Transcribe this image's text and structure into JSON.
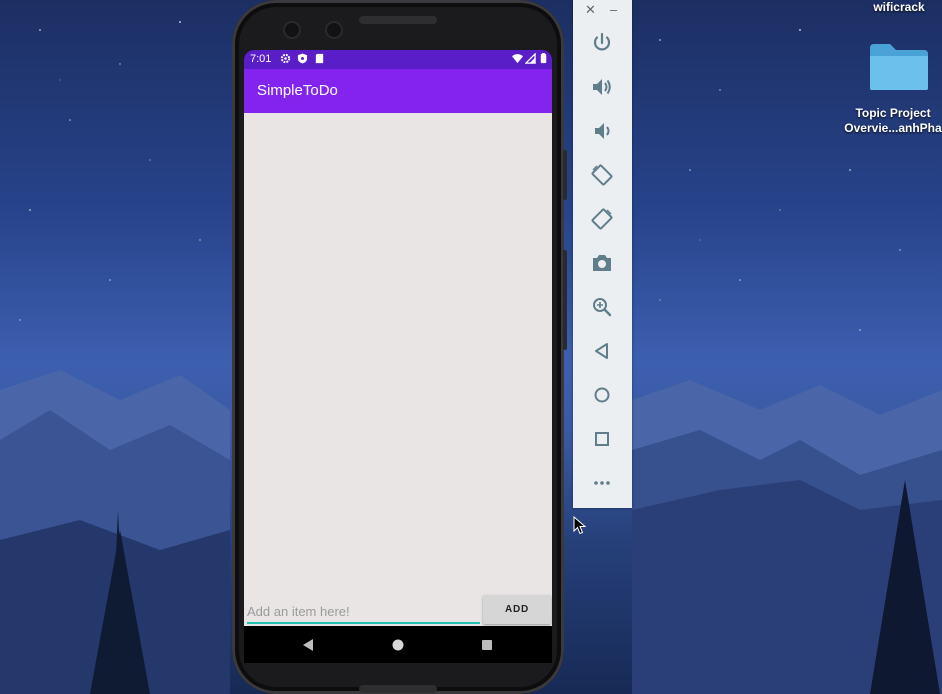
{
  "desktop": {
    "top_label": "wificrack",
    "folder_label_line1": "Topic Project",
    "folder_label_line2": "Overvie...anhPha",
    "folder_color": "#5fb7e6"
  },
  "emulator": {
    "status_bar": {
      "time": "7:01",
      "left_icons": [
        "settings-icon",
        "shield-icon",
        "sd-card-icon"
      ],
      "right_icons": [
        "wifi-icon",
        "signal-icon",
        "battery-icon"
      ]
    },
    "app": {
      "title": "SimpleToDo",
      "primary_color": "#8224ee",
      "status_color": "#5a1ec8",
      "accent_color": "#21c2b1",
      "items": [],
      "input": {
        "placeholder": "Add an item here!",
        "value": ""
      },
      "add_button_label": "ADD"
    },
    "nav_bar": [
      "back-icon",
      "home-icon",
      "recents-icon"
    ]
  },
  "emulator_toolbar": {
    "window_controls": [
      "close-icon",
      "minimize-icon"
    ],
    "buttons": [
      "power-icon",
      "volume-up-icon",
      "volume-down-icon",
      "rotate-left-icon",
      "rotate-right-icon",
      "camera-icon",
      "zoom-icon",
      "back-icon",
      "home-icon",
      "overview-icon",
      "more-icon"
    ]
  }
}
